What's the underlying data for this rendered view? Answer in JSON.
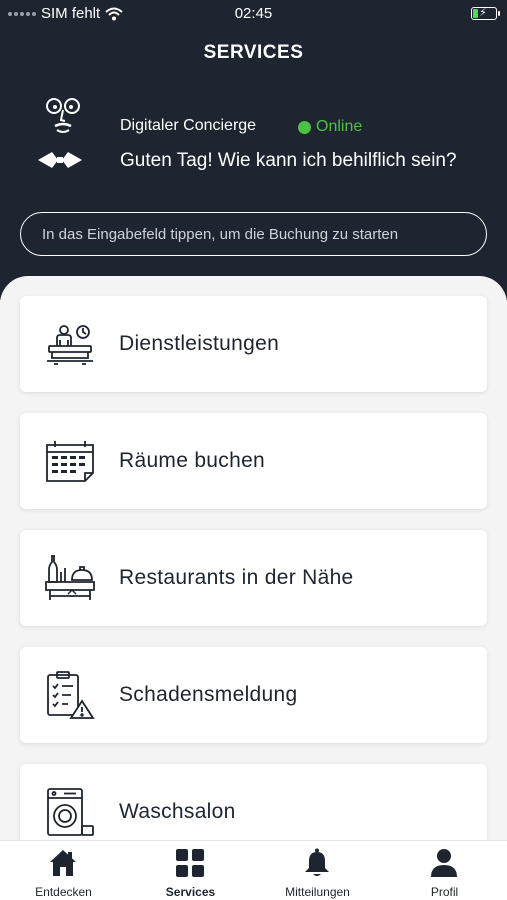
{
  "status_bar": {
    "carrier": "SIM fehlt",
    "time": "02:45"
  },
  "header": {
    "title": "SERVICES"
  },
  "concierge": {
    "name": "Digitaler Concierge",
    "status": "Online",
    "status_color": "#4fc046",
    "greeting": "Guten Tag! Wie kann ich behilflich sein?"
  },
  "booking": {
    "placeholder": "In das Eingabefeld tippen, um die Buchung zu starten"
  },
  "services": [
    {
      "label": "Dienstleistungen",
      "icon": "reception-service-icon"
    },
    {
      "label": "Räume buchen",
      "icon": "calendar-icon"
    },
    {
      "label": "Restaurants in der Nähe",
      "icon": "restaurant-icon"
    },
    {
      "label": "Schadensmeldung",
      "icon": "damage-report-icon"
    },
    {
      "label": "Waschsalon",
      "icon": "washing-machine-icon"
    }
  ],
  "tabs": [
    {
      "label": "Entdecken",
      "icon": "home-icon"
    },
    {
      "label": "Services",
      "icon": "grid-icon"
    },
    {
      "label": "Mitteilungen",
      "icon": "bell-icon"
    },
    {
      "label": "Profil",
      "icon": "user-icon"
    }
  ],
  "colors": {
    "header_bg": "#1e2530",
    "accent_online": "#4fc046",
    "card_bg": "#ffffff"
  }
}
